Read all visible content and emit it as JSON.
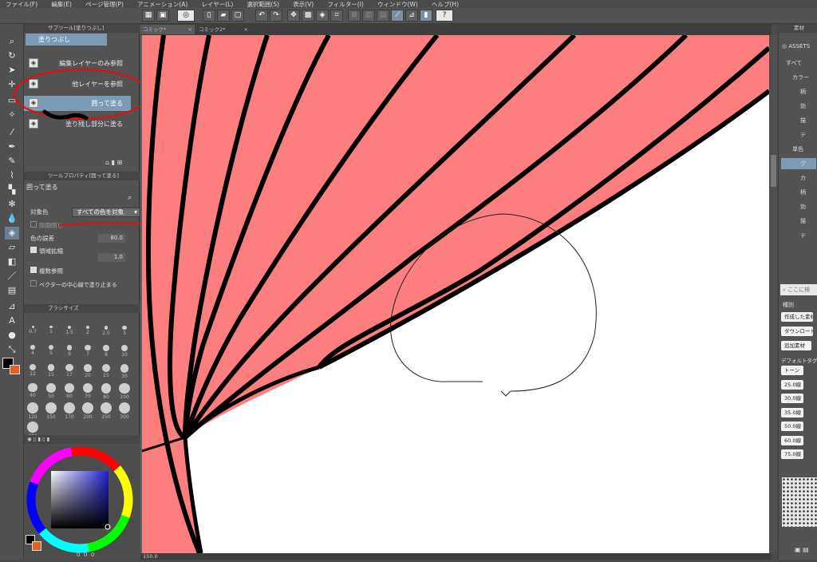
{
  "menu": [
    "ファイル(F)",
    "編集(E)",
    "ページ管理(P)",
    "アニメーション(A)",
    "レイヤー(L)",
    "選択範囲(S)",
    "表示(V)",
    "フィルター(I)",
    "ウィンドウ(W)",
    "ヘルプ(H)"
  ],
  "tabs": {
    "tab1": "コミック*",
    "tab2": "コミック2*"
  },
  "subtool": {
    "header": "サブツール[塗りつぶし]",
    "group_label": "塗りつぶし",
    "items": [
      "編集レイヤーのみ参照",
      "他レイヤーを参照",
      "囲って塗る",
      "塗り残し部分に塗る"
    ],
    "selected_index": 2
  },
  "tool_property": {
    "header": "ツールプロパティ[囲って塗る]",
    "title": "囲って塗る",
    "target_color_label": "対象色",
    "target_color_value": "すべての色を対象",
    "close_gap_label": "隙間閉じ",
    "color_margin_label": "色の誤差",
    "color_margin_value": "80.0",
    "area_scaling_label": "領域拡縮",
    "area_scaling_value": "1.0",
    "multi_ref_label": "複数参照",
    "vector_center_label": "ベクターの中心線で塗り止まる"
  },
  "brush_size": {
    "header": "ブラシサイズ",
    "sizes": [
      "0.7",
      "1",
      "1.5",
      "2",
      "2.5",
      "3",
      "4",
      "5",
      "6",
      "7",
      "8",
      "10",
      "12",
      "15",
      "17",
      "20",
      "25",
      "30",
      "40",
      "50",
      "60",
      "70",
      "80",
      "100",
      "120",
      "150",
      "170",
      "200",
      "250",
      "300",
      "400"
    ]
  },
  "color_panel": {
    "values": [
      "0",
      "0",
      "0"
    ],
    "fg": "#000000",
    "bg": "#e0641e"
  },
  "canvas": {
    "fill": "#fd7e7e",
    "stroke": "#000000"
  },
  "status": {
    "zoom": "150.0"
  },
  "material": {
    "header": "素材",
    "asset_label": "ASSETS",
    "tree": [
      "すべて",
      "カラー",
      "柄",
      "効",
      "描",
      "テ",
      "単色",
      "グ",
      "カ",
      "柄",
      "効",
      "描",
      "テ"
    ],
    "search_placeholder": "ここに検",
    "kind_label": "種別",
    "kind_tags": [
      "作成した素材",
      "ダウンロード",
      "追加素材"
    ],
    "default_tag_label": "デフォルトタグ",
    "default_tags": [
      "トーン",
      "25.0線",
      "30.0線",
      "35.0線",
      "50.0線",
      "60.0線",
      "75.0線"
    ]
  }
}
